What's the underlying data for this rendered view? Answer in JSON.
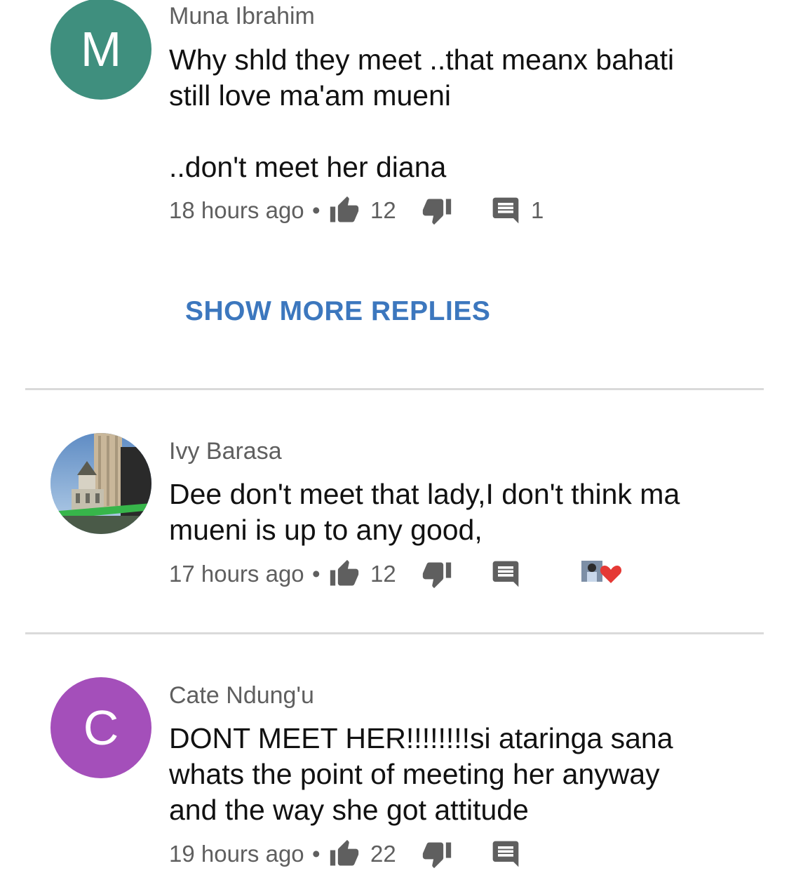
{
  "comments": [
    {
      "avatar_letter": "M",
      "avatar_color": "#3f8f7e",
      "author": "Muna Ibrahim",
      "body_lines": [
        "Why shld they meet ..that meanx bahati still love ma'am mueni",
        "..don't meet her diana"
      ],
      "time": "18 hours ago",
      "likes": "12",
      "replies": "1"
    },
    {
      "avatar_letter": "",
      "avatar_color": "#6b8fb5",
      "author": "Ivy Barasa",
      "body_lines": [
        "Dee don't meet that lady,I don't think ma mueni is up to any good,"
      ],
      "time": "17 hours ago",
      "likes": "12",
      "replies": "",
      "creator_heart": "heart-icon"
    },
    {
      "avatar_letter": "C",
      "avatar_color": "#a44fba",
      "author": "Cate Ndung'u",
      "body_lines": [
        "DONT MEET HER!!!!!!!!si ataringa sana whats the point of meeting her anyway and the way she got attitude"
      ],
      "time": "19 hours ago",
      "likes": "22",
      "replies": ""
    }
  ],
  "show_more_replies": "SHOW MORE REPLIES",
  "dot_separator": "•",
  "icons": {
    "like": "thumbs-up-icon",
    "dislike": "thumbs-down-icon",
    "reply": "comment-icon",
    "heart": "heart-icon"
  },
  "colors": {
    "link_blue": "#3c77be",
    "meta_gray": "#5f5f5f",
    "heart_red": "#e53935"
  }
}
